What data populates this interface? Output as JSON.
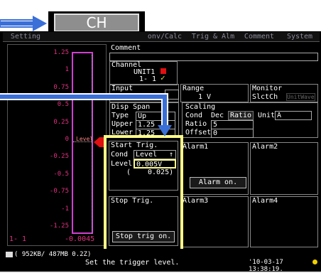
{
  "ch_key": {
    "label": "CH"
  },
  "tabs": [
    "Setting",
    "onv/Calc",
    "Trig & Alm",
    "Comment",
    "System"
  ],
  "waveform": {
    "y_ticks": [
      "1.25",
      "1",
      "0.75",
      "0.5",
      "0.25",
      "0",
      "-0.25",
      "-0.5",
      "-0.75",
      "-1",
      "-1.25"
    ],
    "bottom_left": "1- 1",
    "bottom_right": "-0.0045",
    "level_marker": "Level"
  },
  "comment": {
    "label": "Comment"
  },
  "channel": {
    "label": "Channel",
    "unit": "UNIT1",
    "ch": "1- 1"
  },
  "input": {
    "label": "Input"
  },
  "range": {
    "label": "Range",
    "value": "1 V"
  },
  "monitor": {
    "label": "Monitor",
    "value": "SlctCh",
    "dim": "UnitWave"
  },
  "disp_span": {
    "label": "Disp Span",
    "type_label": "Type",
    "type_value": "Up",
    "upper_label": "Upper",
    "upper_value": "1.25",
    "lower_label": "Lower",
    "lower_value": "1.25"
  },
  "scaling": {
    "label": "Scaling",
    "cond_label": "Cond",
    "cond_dec": "Dec",
    "cond_ratio": "Ratio",
    "unit_label": "Unit",
    "unit_value": "A",
    "ratio_label": "Ratio",
    "ratio_value": "5",
    "offset_label": "Offset",
    "offset_value": "0"
  },
  "start_trig": {
    "label": "Start Trig.",
    "cond_label": "Cond",
    "cond_value": "Level",
    "level_label": "Level",
    "level_value": "0.005V",
    "level_sub_open": "(",
    "level_sub": "0.025)"
  },
  "alarm1": {
    "label": "Alarm1",
    "button": "Alarm on."
  },
  "alarm2": {
    "label": "Alarm2"
  },
  "alarm3": {
    "label": "Alarm3"
  },
  "alarm4": {
    "label": "Alarm4"
  },
  "stop_trig": {
    "label": "Stop Trig.",
    "button": "Stop trig on."
  },
  "status": {
    "left": "( 952KB/ 487MB  0.2Z)",
    "message": "Set the trigger level.",
    "datetime": "'10-03-17 13:38:19."
  },
  "colors": {
    "highlight": "#fffd8a",
    "arrow": "#3a6fd8",
    "wave": "#d040d0",
    "ticks": "#e03080",
    "trigger": "#e01010"
  }
}
